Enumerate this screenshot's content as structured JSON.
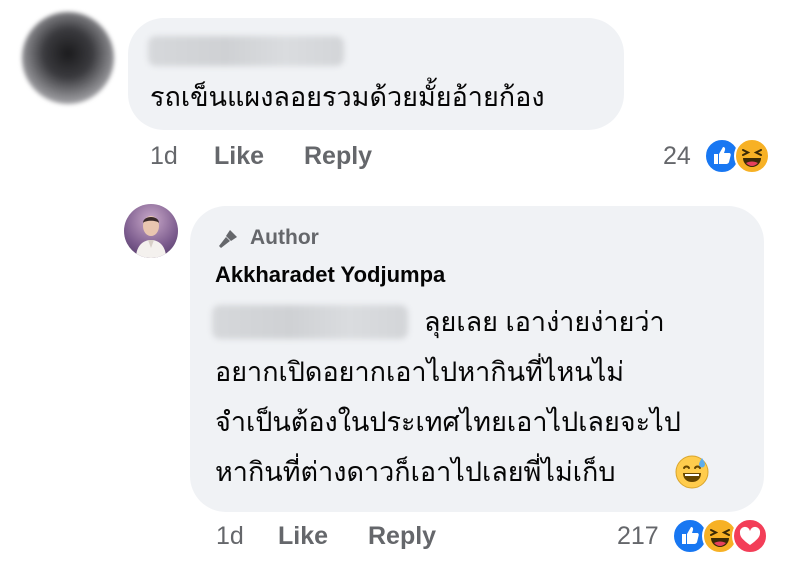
{
  "comment": {
    "text": "รถเข็นแผงลอยรวมด้วยมั้ยอ้ายก้อง",
    "time": "1d",
    "like_label": "Like",
    "reply_label": "Reply",
    "reaction_count": "24",
    "reactions": [
      "like-icon",
      "haha-icon"
    ]
  },
  "reply": {
    "badge_label": "Author",
    "author_name": "Akkharadet Yodjumpa",
    "lines": [
      "ลุยเลย เอาง่ายง่ายว่า",
      "อยากเปิดอยากเอาไปหากินที่ไหนไม่",
      "จำเป็นต้องในประเทศไทยเอาไปเลยจะไป",
      "หากินที่ต่างดาวก็เอาไปเลยพี่ไม่เก็บ"
    ],
    "emoji": "😅",
    "time": "1d",
    "like_label": "Like",
    "reply_label": "Reply",
    "reaction_count": "217",
    "reactions": [
      "like-icon",
      "haha-icon",
      "love-icon"
    ]
  },
  "colors": {
    "bubble": "#f0f2f5",
    "like": "#1877f2",
    "haha": "#f7b125",
    "love": "#f33e58",
    "meta": "#65676b"
  }
}
